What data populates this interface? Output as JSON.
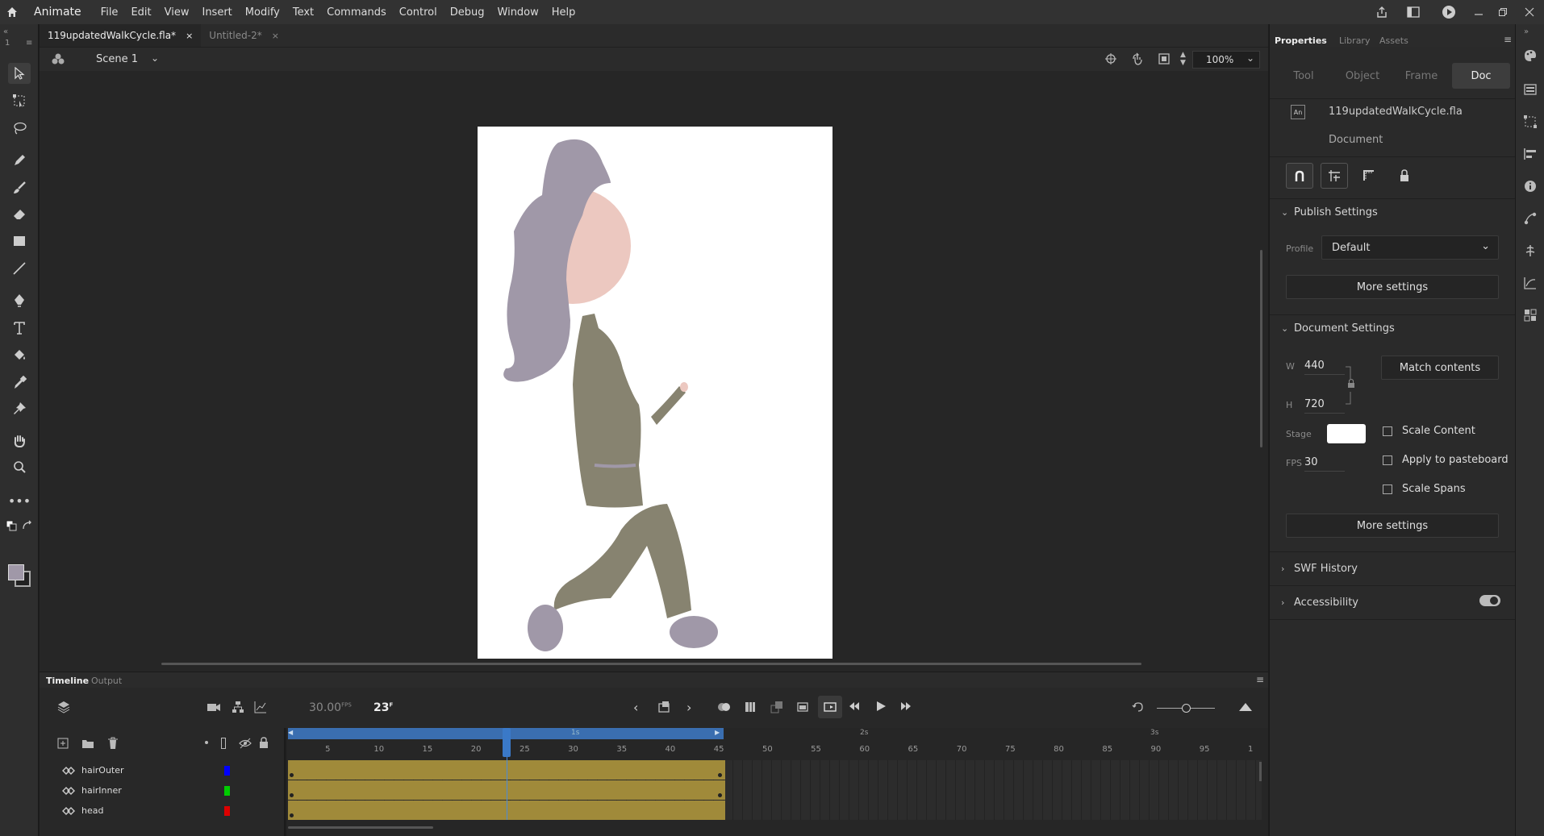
{
  "app": {
    "name": "Animate"
  },
  "menu": [
    "File",
    "Edit",
    "View",
    "Insert",
    "Modify",
    "Text",
    "Commands",
    "Control",
    "Debug",
    "Window",
    "Help"
  ],
  "tabs": [
    {
      "label": "119updatedWalkCycle.fla*",
      "active": true
    },
    {
      "label": "Untitled-2*",
      "active": false
    }
  ],
  "scene": {
    "label": "Scene 1",
    "zoom": "100%"
  },
  "toolbar_top": {
    "frame_label": "1"
  },
  "properties": {
    "tabs": [
      "Properties",
      "Library",
      "Assets"
    ],
    "subtabs": [
      "Tool",
      "Object",
      "Frame",
      "Doc"
    ],
    "active_subtab": "Doc",
    "doc_badge": "An",
    "filename": "119updatedWalkCycle.fla",
    "doc_type": "Document",
    "publish": {
      "title": "Publish Settings",
      "profile_label": "Profile",
      "profile_value": "Default",
      "more": "More settings"
    },
    "docsettings": {
      "title": "Document Settings",
      "w_label": "W",
      "w": "440",
      "h_label": "H",
      "h": "720",
      "match": "Match contents",
      "stage_label": "Stage",
      "fps_label": "FPS",
      "fps": "30",
      "scale_content": "Scale Content",
      "apply_pasteboard": "Apply to pasteboard",
      "scale_spans": "Scale Spans",
      "more": "More settings"
    },
    "swf_history": "SWF History",
    "accessibility": "Accessibility"
  },
  "timeline": {
    "tabs": [
      "Timeline",
      "Output"
    ],
    "fps": "30.00",
    "fps_unit": "FPS",
    "frame": "23",
    "frame_unit": "F",
    "current_frame": 23,
    "span_end": 45,
    "ticks": [
      "5",
      "10",
      "15",
      "20",
      "25",
      "30",
      "35",
      "40",
      "45",
      "50",
      "55",
      "60",
      "65",
      "70",
      "75",
      "80",
      "85",
      "90",
      "95",
      "1"
    ],
    "seconds": [
      "1s",
      "2s",
      "3s"
    ],
    "layers": [
      {
        "name": "hairOuter",
        "color": "#0000ff"
      },
      {
        "name": "hairInner",
        "color": "#00cc00"
      },
      {
        "name": "head",
        "color": "#dd0000"
      }
    ]
  },
  "colors": {
    "accent": "#3a79c8",
    "frames": "#a08a3a",
    "stage": "#ffffff",
    "hair": "#a098a8",
    "skin": "#ecc8c0",
    "body": "#878370"
  }
}
